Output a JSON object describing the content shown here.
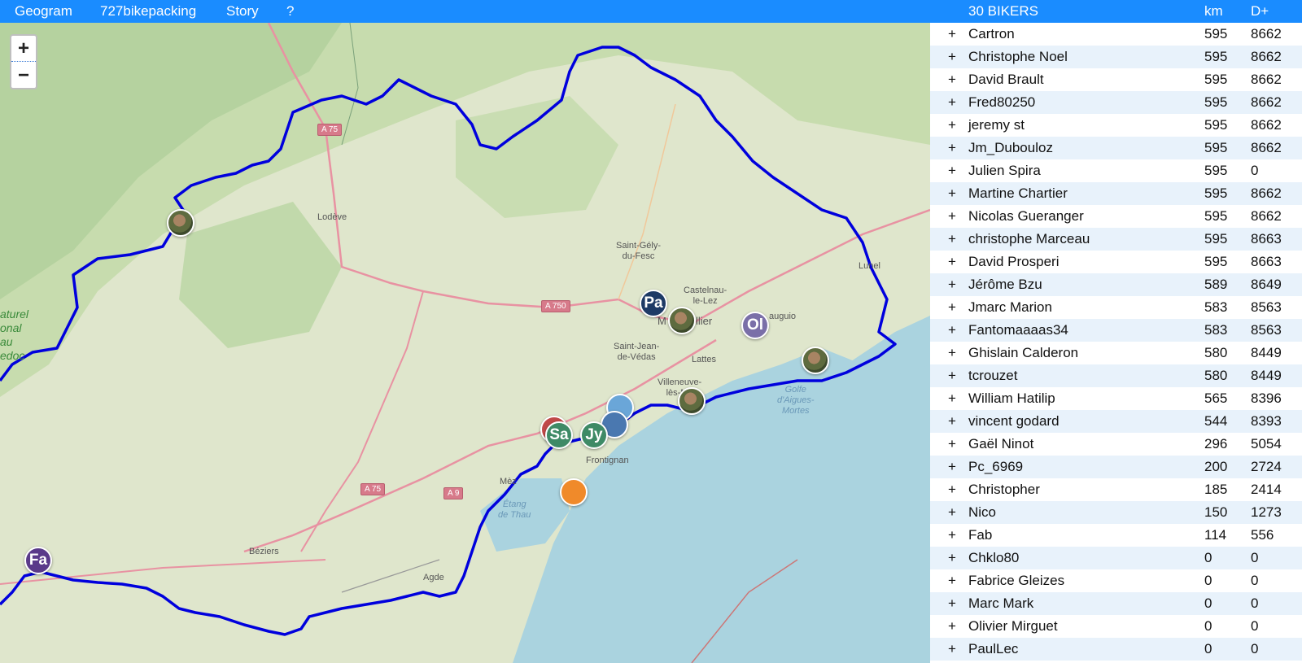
{
  "nav": {
    "items": [
      "Geogram",
      "727bikepacking",
      "Story",
      "?"
    ]
  },
  "table": {
    "title": "30 BIKERS",
    "col_km": "km",
    "col_dplus": "D+",
    "expand_symbol": "+",
    "riders": [
      {
        "name": "Cartron",
        "km": "595",
        "dplus": "8662"
      },
      {
        "name": "Christophe Noel",
        "km": "595",
        "dplus": "8662"
      },
      {
        "name": "David Brault",
        "km": "595",
        "dplus": "8662"
      },
      {
        "name": "Fred80250",
        "km": "595",
        "dplus": "8662"
      },
      {
        "name": "jeremy st",
        "km": "595",
        "dplus": "8662"
      },
      {
        "name": "Jm_Dubouloz",
        "km": "595",
        "dplus": "8662"
      },
      {
        "name": "Julien Spira",
        "km": "595",
        "dplus": "0"
      },
      {
        "name": "Martine Chartier",
        "km": "595",
        "dplus": "8662"
      },
      {
        "name": "Nicolas Gueranger",
        "km": "595",
        "dplus": "8662"
      },
      {
        "name": "christophe Marceau",
        "km": "595",
        "dplus": "8663"
      },
      {
        "name": "David Prosperi",
        "km": "595",
        "dplus": "8663"
      },
      {
        "name": "Jérôme Bzu",
        "km": "589",
        "dplus": "8649"
      },
      {
        "name": "Jmarc Marion",
        "km": "583",
        "dplus": "8563"
      },
      {
        "name": "Fantomaaaas34",
        "km": "583",
        "dplus": "8563"
      },
      {
        "name": "Ghislain Calderon",
        "km": "580",
        "dplus": "8449"
      },
      {
        "name": "tcrouzet",
        "km": "580",
        "dplus": "8449"
      },
      {
        "name": "William Hatilip",
        "km": "565",
        "dplus": "8396"
      },
      {
        "name": "vincent godard",
        "km": "544",
        "dplus": "8393"
      },
      {
        "name": "Gaël Ninot",
        "km": "296",
        "dplus": "5054"
      },
      {
        "name": "Pc_6969",
        "km": "200",
        "dplus": "2724"
      },
      {
        "name": "Christopher",
        "km": "185",
        "dplus": "2414"
      },
      {
        "name": "Nico",
        "km": "150",
        "dplus": "1273"
      },
      {
        "name": "Fab",
        "km": "114",
        "dplus": "556"
      },
      {
        "name": "Chklo80",
        "km": "0",
        "dplus": "0"
      },
      {
        "name": "Fabrice Gleizes",
        "km": "0",
        "dplus": "0"
      },
      {
        "name": "Marc Mark",
        "km": "0",
        "dplus": "0"
      },
      {
        "name": "Olivier Mirguet",
        "km": "0",
        "dplus": "0"
      },
      {
        "name": "PaulLec",
        "km": "0",
        "dplus": "0"
      }
    ]
  },
  "map": {
    "zoom_in": "+",
    "zoom_out": "−",
    "place_labels": {
      "lodeve": "Lodève",
      "saint_gely": "Saint-Gély-\ndu-Fesc",
      "castelnau": "Castelnau-\nle-Lez",
      "montpellier_m": "M",
      "montpellier_rest": "llier",
      "mauguio": "auguio",
      "lunel": "Lunel",
      "saint_jean": "Saint-Jean-\nde-Védas",
      "lattes": "Lattes",
      "villeneuve": "Villeneuve-\nlès-Ma",
      "frontignan": "Frontignan",
      "meze": "Mèz",
      "beziers": "Béziers",
      "agde": "Agde"
    },
    "sea_labels": {
      "golfe": "Golfe\nd'Aigues-\nMortes",
      "etang": "Étang\nde Thau"
    },
    "park_label": "aturel\nonal\nau\nedoc",
    "roads": {
      "a75_north": "A 75",
      "a750": "A 750",
      "a75_south": "A 75",
      "a9": "A 9"
    },
    "markers": {
      "pa": "Pa",
      "ol": "Ol",
      "sa": "Sa",
      "jy": "Jy",
      "fa": "Fa"
    },
    "colors": {
      "route": "#0000dd",
      "sea": "#aad3df",
      "land": "#dfe6cc",
      "forest": "#b5d29f",
      "marker_pa": "#1e3a66",
      "marker_ol": "#7a6fa8",
      "marker_sa": "#3e8a66",
      "marker_jy": "#3e8a66",
      "marker_fa": "#5a3a8a"
    }
  }
}
